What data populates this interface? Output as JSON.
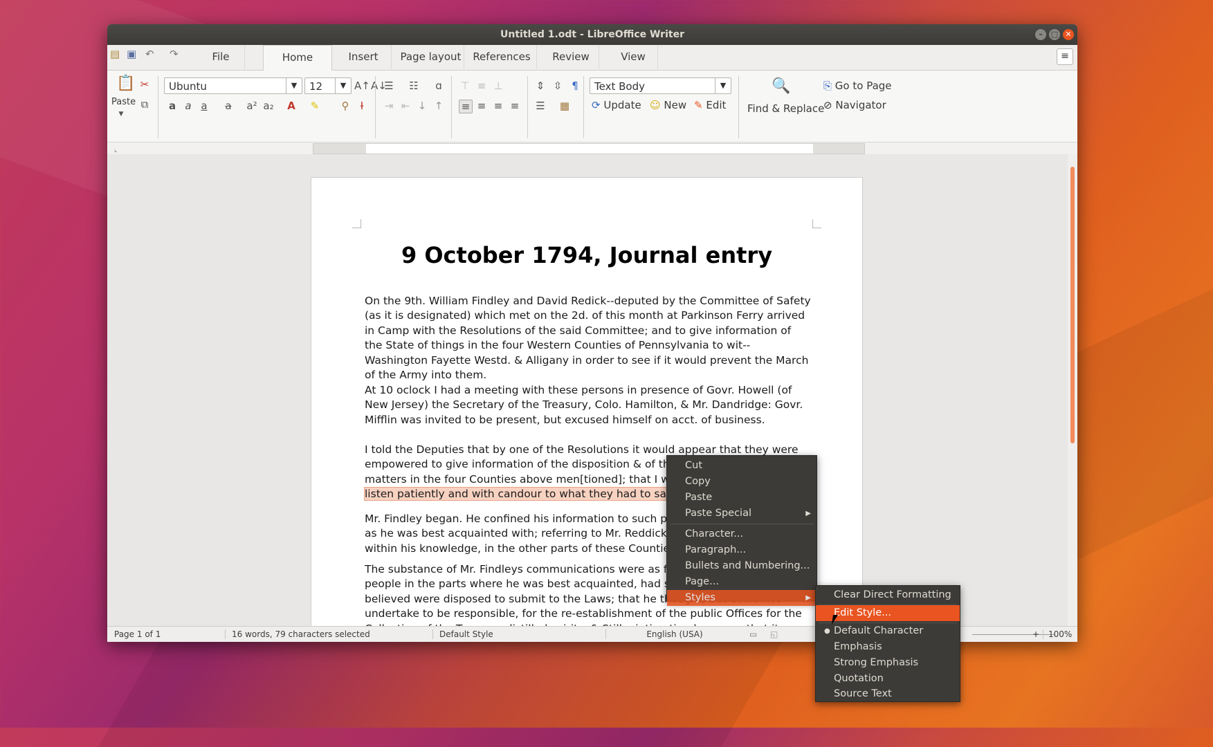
{
  "window": {
    "title": "Untitled 1.odt - LibreOffice Writer"
  },
  "tabs": [
    "File",
    "Home",
    "Insert",
    "Page layout",
    "References",
    "Review",
    "View"
  ],
  "ribbon": {
    "paste_label": "Paste",
    "font_name": "Ubuntu",
    "font_size": "12",
    "paragraph_style": "Text Body",
    "update_label": "Update",
    "new_label": "New",
    "edit_label": "Edit",
    "find_replace_label": "Find & Replace",
    "goto_page_label": "Go to Page",
    "navigator_label": "Navigator"
  },
  "document": {
    "title": "9 October 1794, Journal entry",
    "paragraphs": [
      "On the 9th. William Findley and David Redick--deputed by the Committee of Safety (as it is designated) which met on the 2d. of this month at Parkinson Ferry arrived in Camp with the Resolutions of the said Committee; and to give information of the State of things in the four Western Counties of Pennsylvania to wit--Washington Fayette Westd. & Alligany in order to see if it would prevent the March of the Army into them.",
      "At 10 oclock I had a meeting with these persons in presence of Govr. Howell (of New Jersey) the Secretary of the Treasury, Colo. Hamilton, & Mr. Dandridge: Govr. Mifflin was invited to be present, but excused himself on acct. of business.",
      "Mr. Findley began. He confined his information to such parts of the four Counties as he was best acquainted with; referring to Mr. Reddick for a recital of what fell within his knowledge, in the other parts of these Counties.",
      "The substance of Mr. Findleys communications were as follows--viz.--That the people in the parts where he was best acquainted, had seen there folly; and he believed were disposed to submit to the Laws; that he thought, but could not undertake to be responsible, for the re-establishment of the public Offices for the Collection of the Taxes on distilled spirits, & Stills--intimating however, that it might be best for the present, & until the peoples minds were a little more tranquilized, to hold the Office of Inspection at Pittsburgh under the protection, or at least under the influence of the"
    ],
    "para3_before": "I told the Deputies that by one of the Resolutions it would appear that they were empowered to give information of the disposition & of the existing state of matters in the four Counties above men[tioned]; that I was re",
    "para3_selected": "ady to hear & would listen patiently and with candour to what they had to say."
  },
  "status": {
    "page": "Page 1 of 1",
    "words": "16 words, 79 characters selected",
    "style": "Default Style",
    "language": "English (USA)",
    "zoom": "100%"
  },
  "context_menu": {
    "items": [
      "Cut",
      "Copy",
      "Paste",
      "Paste Special",
      "Character...",
      "Paragraph...",
      "Bullets and Numbering...",
      "Page...",
      "Styles"
    ]
  },
  "styles_submenu": {
    "items": [
      "Clear Direct Formatting",
      "Edit Style...",
      "Default Character",
      "Emphasis",
      "Strong Emphasis",
      "Quotation",
      "Source Text"
    ]
  },
  "colors": {
    "accent": "#e95420",
    "menu_bg": "#3c3b37",
    "selection": "#f8d2c1"
  }
}
